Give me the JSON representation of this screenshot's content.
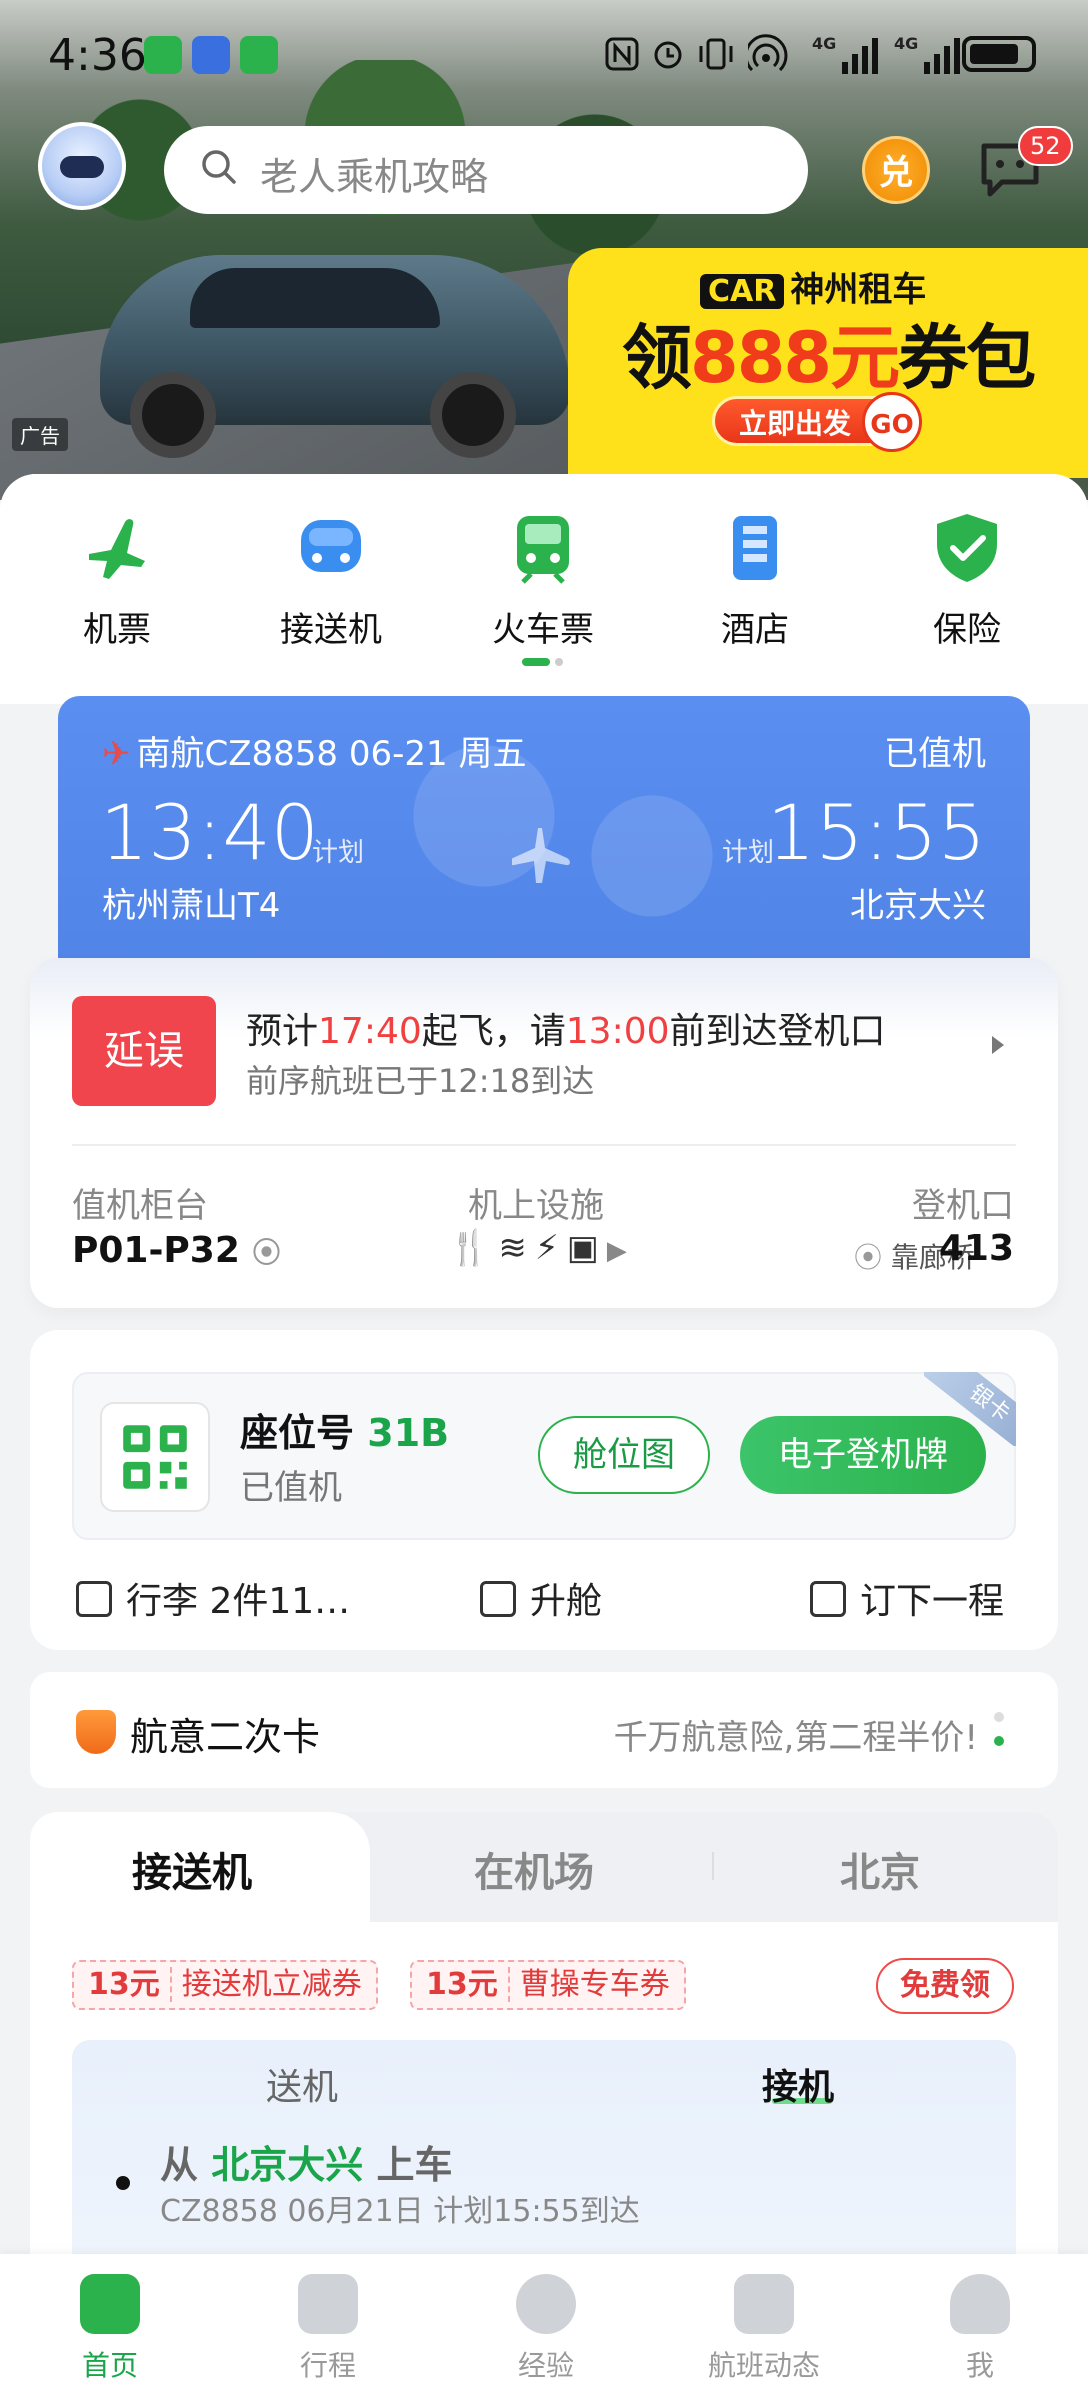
{
  "status_bar": {
    "time": "4:36",
    "network": "4G",
    "network2": "4G"
  },
  "banner": {
    "brand_box": "CAR",
    "brand": "神州租车",
    "headline_pre": "领",
    "headline_red": "888元",
    "headline_post": "券包",
    "cta": "立即出发",
    "cta_badge": "GO",
    "ad_tag": "广告"
  },
  "search": {
    "placeholder": "老人乘机攻略",
    "coin_label": "兑",
    "message_badge": "52"
  },
  "categories": [
    {
      "label": "机票",
      "icon": "plane-icon",
      "color": "#2bb24c"
    },
    {
      "label": "接送机",
      "icon": "car-icon",
      "color": "#3a8ef0"
    },
    {
      "label": "火车票",
      "icon": "train-icon",
      "color": "#2bb24c"
    },
    {
      "label": "酒店",
      "icon": "hotel-icon",
      "color": "#3a8ef0"
    },
    {
      "label": "保险",
      "icon": "shield-icon",
      "color": "#2bb24c"
    }
  ],
  "flight": {
    "airline": "南航CZ8858 06-21 周五",
    "status": "已值机",
    "dep_time": "13:40",
    "dep_plan": "计划",
    "arr_plan": "计划",
    "arr_time": "15:55",
    "dep_airport": "杭州萧山T4",
    "arr_airport": "北京大兴",
    "accent": "#4f84e6"
  },
  "delay": {
    "badge": "延误",
    "line1_a": "预计",
    "line1_time1": "17:40",
    "line1_b": "起飞，请",
    "line1_time2": "13:00",
    "line1_c": "前到达登机口",
    "line2": "前序航班已于12:18到达",
    "checkin_label": "值机柜台",
    "checkin_value": "P01-P32",
    "facilities_label": "机上设施",
    "gate_label": "登机口",
    "gate_sub": "靠廊桥",
    "gate_value": "413"
  },
  "seat": {
    "label": "座位号",
    "number": "31B",
    "state": "已值机",
    "seatmap_btn": "舱位图",
    "eboard_btn": "电子登机牌",
    "tier": "银卡",
    "actions": [
      "行李 2件11…",
      "升舱",
      "订下一程"
    ]
  },
  "insurance": {
    "title": "航意二次卡",
    "desc": "千万航意险,第二程半价!"
  },
  "transfer": {
    "tabs": [
      "接送机",
      "在机场",
      "北京"
    ],
    "coupons": [
      {
        "amount": "13元",
        "text": "接送机立减券"
      },
      {
        "amount": "13元",
        "text": "曹操专车券"
      }
    ],
    "free_btn": "免费领",
    "send_label": "送机",
    "pick_label": "接机",
    "from_pre": "从",
    "from_place": "北京大兴",
    "from_post": "上车",
    "flight_line": "CZ8858 06月21日 计划15:55到达"
  },
  "nav": [
    {
      "label": "首页",
      "icon": "home-icon",
      "active": true
    },
    {
      "label": "行程",
      "icon": "suitcase-icon",
      "active": false
    },
    {
      "label": "经验",
      "icon": "chat-icon",
      "active": false
    },
    {
      "label": "航班动态",
      "icon": "plane-icon",
      "active": false
    },
    {
      "label": "我",
      "icon": "user-icon",
      "active": false
    }
  ]
}
